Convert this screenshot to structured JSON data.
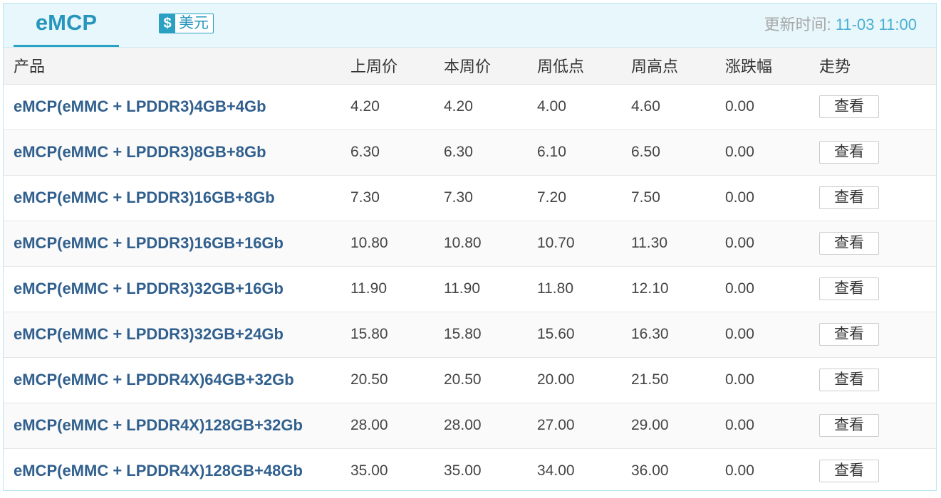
{
  "header": {
    "tab_label": "eMCP",
    "currency_icon": "$",
    "currency_label": "美元",
    "update_label": "更新时间: ",
    "update_value": "11-03 11:00"
  },
  "table": {
    "columns": [
      "产品",
      "上周价",
      "本周价",
      "周低点",
      "周高点",
      "涨跌幅",
      "走势"
    ],
    "view_label": "查看",
    "rows": [
      {
        "product": "eMCP(eMMC + LPDDR3)4GB+4Gb",
        "last_week": "4.20",
        "this_week": "4.20",
        "low": "4.00",
        "high": "4.60",
        "change": "0.00"
      },
      {
        "product": "eMCP(eMMC + LPDDR3)8GB+8Gb",
        "last_week": "6.30",
        "this_week": "6.30",
        "low": "6.10",
        "high": "6.50",
        "change": "0.00"
      },
      {
        "product": "eMCP(eMMC + LPDDR3)16GB+8Gb",
        "last_week": "7.30",
        "this_week": "7.30",
        "low": "7.20",
        "high": "7.50",
        "change": "0.00"
      },
      {
        "product": "eMCP(eMMC + LPDDR3)16GB+16Gb",
        "last_week": "10.80",
        "this_week": "10.80",
        "low": "10.70",
        "high": "11.30",
        "change": "0.00"
      },
      {
        "product": "eMCP(eMMC + LPDDR3)32GB+16Gb",
        "last_week": "11.90",
        "this_week": "11.90",
        "low": "11.80",
        "high": "12.10",
        "change": "0.00"
      },
      {
        "product": "eMCP(eMMC + LPDDR3)32GB+24Gb",
        "last_week": "15.80",
        "this_week": "15.80",
        "low": "15.60",
        "high": "16.30",
        "change": "0.00"
      },
      {
        "product": "eMCP(eMMC + LPDDR4X)64GB+32Gb",
        "last_week": "20.50",
        "this_week": "20.50",
        "low": "20.00",
        "high": "21.50",
        "change": "0.00"
      },
      {
        "product": "eMCP(eMMC + LPDDR4X)128GB+32Gb",
        "last_week": "28.00",
        "this_week": "28.00",
        "low": "27.00",
        "high": "29.00",
        "change": "0.00"
      },
      {
        "product": "eMCP(eMMC + LPDDR4X)128GB+48Gb",
        "last_week": "35.00",
        "this_week": "35.00",
        "low": "34.00",
        "high": "36.00",
        "change": "0.00"
      }
    ]
  }
}
